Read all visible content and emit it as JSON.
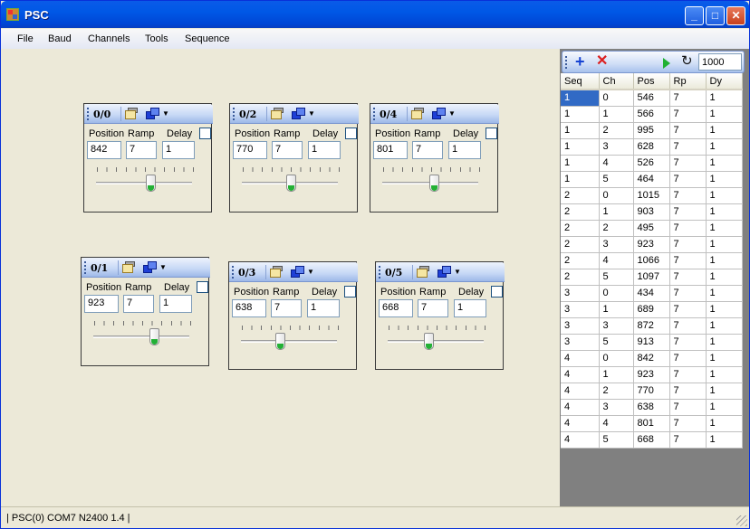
{
  "window": {
    "title": "PSC"
  },
  "menu": [
    "File",
    "Baud",
    "Channels",
    "Tools",
    "Sequence"
  ],
  "field_labels": {
    "position": "Position",
    "ramp": "Ramp",
    "delay": "Delay"
  },
  "channels": [
    {
      "title": "0/0",
      "position": "842",
      "ramp": "7",
      "delay": "1",
      "slider_fraction": 0.58
    },
    {
      "title": "0/2",
      "position": "770",
      "ramp": "7",
      "delay": "1",
      "slider_fraction": 0.52
    },
    {
      "title": "0/4",
      "position": "801",
      "ramp": "7",
      "delay": "1",
      "slider_fraction": 0.55
    },
    {
      "title": "0/1",
      "position": "923",
      "ramp": "7",
      "delay": "1",
      "slider_fraction": 0.65
    },
    {
      "title": "0/3",
      "position": "638",
      "ramp": "7",
      "delay": "1",
      "slider_fraction": 0.4
    },
    {
      "title": "0/5",
      "position": "668",
      "ramp": "7",
      "delay": "1",
      "slider_fraction": 0.42
    }
  ],
  "sequence": {
    "speed": "1000",
    "columns": [
      "Seq",
      "Ch",
      "Pos",
      "Rp",
      "Dy"
    ],
    "rows": [
      [
        "1",
        "0",
        "546",
        "7",
        "1"
      ],
      [
        "1",
        "1",
        "566",
        "7",
        "1"
      ],
      [
        "1",
        "2",
        "995",
        "7",
        "1"
      ],
      [
        "1",
        "3",
        "628",
        "7",
        "1"
      ],
      [
        "1",
        "4",
        "526",
        "7",
        "1"
      ],
      [
        "1",
        "5",
        "464",
        "7",
        "1"
      ],
      [
        "2",
        "0",
        "1015",
        "7",
        "1"
      ],
      [
        "2",
        "1",
        "903",
        "7",
        "1"
      ],
      [
        "2",
        "2",
        "495",
        "7",
        "1"
      ],
      [
        "2",
        "3",
        "923",
        "7",
        "1"
      ],
      [
        "2",
        "4",
        "1066",
        "7",
        "1"
      ],
      [
        "2",
        "5",
        "1097",
        "7",
        "1"
      ],
      [
        "3",
        "0",
        "434",
        "7",
        "1"
      ],
      [
        "3",
        "1",
        "689",
        "7",
        "1"
      ],
      [
        "3",
        "3",
        "872",
        "7",
        "1"
      ],
      [
        "3",
        "5",
        "913",
        "7",
        "1"
      ],
      [
        "4",
        "0",
        "842",
        "7",
        "1"
      ],
      [
        "4",
        "1",
        "923",
        "7",
        "1"
      ],
      [
        "4",
        "2",
        "770",
        "7",
        "1"
      ],
      [
        "4",
        "3",
        "638",
        "7",
        "1"
      ],
      [
        "4",
        "4",
        "801",
        "7",
        "1"
      ],
      [
        "4",
        "5",
        "668",
        "7",
        "1"
      ]
    ]
  },
  "status": "| PSC(0) COM7 N2400 1.4 |",
  "icons": {
    "minimize": "minimize-icon",
    "maximize": "maximize-icon",
    "close": "close-icon",
    "add": "plus-icon",
    "delete": "delete-x-icon",
    "play": "play-icon",
    "loop": "loop-icon"
  },
  "colors": {
    "titlebar": "#0058e6",
    "selection": "#316ac5",
    "play": "#1fb132",
    "delete": "#dc1e1e",
    "add": "#1643d3"
  }
}
